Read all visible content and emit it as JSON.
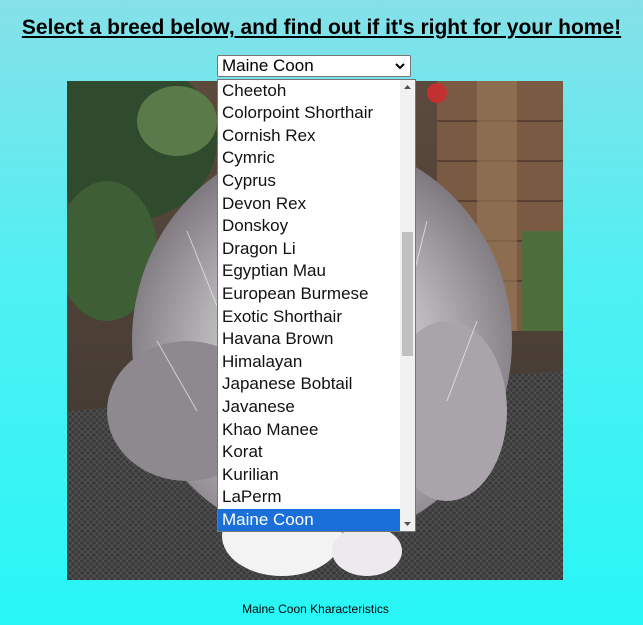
{
  "heading": "Select a breed below, and find out if it's right for your home!",
  "select": {
    "selected_value": "Maine Coon",
    "icon": "chevron-down-icon"
  },
  "dropdown": {
    "options": [
      "Cheetoh",
      "Colorpoint Shorthair",
      "Cornish Rex",
      "Cymric",
      "Cyprus",
      "Devon Rex",
      "Donskoy",
      "Dragon Li",
      "Egyptian Mau",
      "European Burmese",
      "Exotic Shorthair",
      "Havana Brown",
      "Himalayan",
      "Japanese Bobtail",
      "Javanese",
      "Khao Manee",
      "Korat",
      "Kurilian",
      "LaPerm",
      "Maine Coon"
    ],
    "selected_index": 19,
    "scroll_up_icon": "triangle-up-icon",
    "scroll_down_icon": "triangle-down-icon"
  },
  "photo": {
    "subject": "long-haired grey and white cat sitting on a mesh table"
  },
  "caption": "Maine Coon Kharacteristics",
  "colors": {
    "selected_option_bg": "#1a6fd8",
    "background_top": "#86e0e8",
    "background_bottom": "#28f6f6"
  }
}
